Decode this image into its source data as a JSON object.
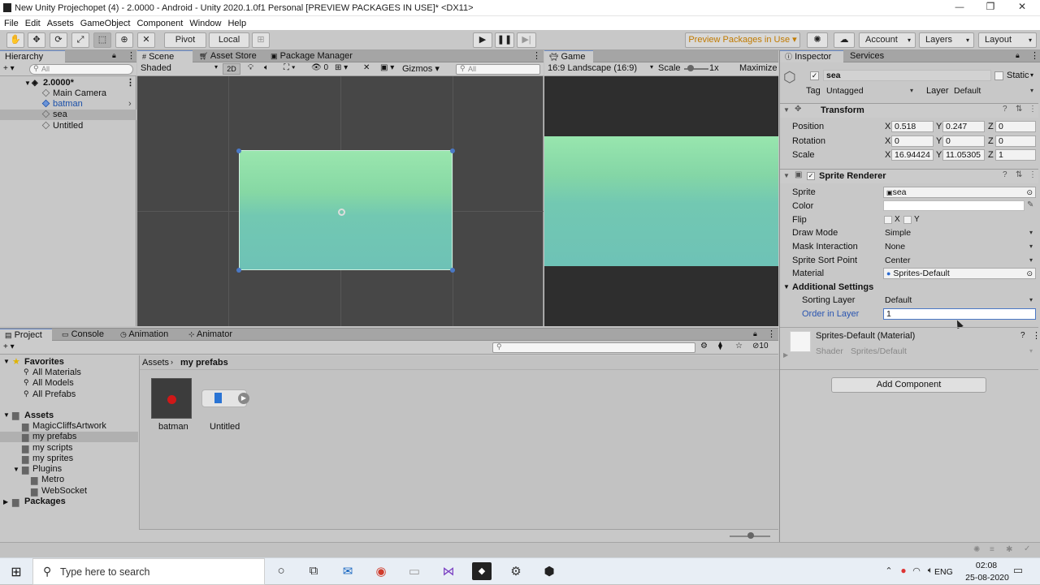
{
  "window": {
    "title": "New Unity Projechopet (4) - 2.0000 - Android - Unity 2020.1.0f1 Personal [PREVIEW PACKAGES IN USE]* <DX11>",
    "minimize": "—",
    "maximize": "❐",
    "close": "✕"
  },
  "menu": [
    "File",
    "Edit",
    "Assets",
    "GameObject",
    "Component",
    "Window",
    "Help"
  ],
  "toolbar": {
    "pivot": "Pivot",
    "local": "Local",
    "preview_packages": "Preview Packages in Use ▾",
    "account": "Account",
    "layers": "Layers",
    "layout": "Layout"
  },
  "hierarchy": {
    "tab": "Hierarchy",
    "search_placeholder": "All",
    "add": "+ ▾",
    "scene": "2.0000*",
    "items": [
      "Main Camera",
      "batman",
      "sea",
      "Untitled"
    ]
  },
  "scene_view": {
    "tabs": [
      "Scene",
      "Asset Store",
      "Package Manager"
    ],
    "shading": "Shaded",
    "mode_2d": "2D",
    "fx_count": "0",
    "gizmos": "Gizmos",
    "search_placeholder": "All"
  },
  "game_view": {
    "tab": "Game",
    "aspect": "16:9 Landscape (16:9)",
    "scale_label": "Scale",
    "scale_value": "1x",
    "maximize": "Maximize"
  },
  "inspector": {
    "tabs": [
      "Inspector",
      "Services"
    ],
    "object_name": "sea",
    "static_label": "Static",
    "tag_label": "Tag",
    "tag_value": "Untagged",
    "layer_label": "Layer",
    "layer_value": "Default",
    "transform": {
      "title": "Transform",
      "position_label": "Position",
      "position": {
        "x": "0.518",
        "y": "0.247",
        "z": "0"
      },
      "rotation_label": "Rotation",
      "rotation": {
        "x": "0",
        "y": "0",
        "z": "0"
      },
      "scale_label": "Scale",
      "scale": {
        "x": "16.94424",
        "y": "11.05305",
        "z": "1"
      }
    },
    "sprite_renderer": {
      "title": "Sprite Renderer",
      "sprite_label": "Sprite",
      "sprite_value": "sea",
      "color_label": "Color",
      "flip_label": "Flip",
      "flip_x": "X",
      "flip_y": "Y",
      "draw_mode_label": "Draw Mode",
      "draw_mode_value": "Simple",
      "mask_label": "Mask Interaction",
      "mask_value": "None",
      "sort_point_label": "Sprite Sort Point",
      "sort_point_value": "Center",
      "material_label": "Material",
      "material_value": "Sprites-Default",
      "additional_settings": "Additional Settings",
      "sorting_layer_label": "Sorting Layer",
      "sorting_layer_value": "Default",
      "order_label": "Order in Layer",
      "order_value": "1"
    },
    "material_block": {
      "title": "Sprites-Default (Material)",
      "shader_label": "Shader",
      "shader_value": "Sprites/Default"
    },
    "add_component": "Add Component"
  },
  "project": {
    "tabs": [
      "Project",
      "Console",
      "Animation",
      "Animator"
    ],
    "add": "+ ▾",
    "hidden_count": "10",
    "breadcrumb": [
      "Assets",
      "my prefabs"
    ],
    "favorites_label": "Favorites",
    "favorites": [
      "All Materials",
      "All Models",
      "All Prefabs"
    ],
    "assets_label": "Assets",
    "folders": [
      "MagicCliffsArtwork",
      "my prefabs",
      "my scripts",
      "my sprites"
    ],
    "plugins_label": "Plugins",
    "plugin_folders": [
      "Metro",
      "WebSocket"
    ],
    "packages_label": "Packages",
    "grid_items": [
      "batman",
      "Untitled"
    ]
  },
  "taskbar": {
    "search_placeholder": "Type here to search",
    "language": "ENG",
    "time": "02:08",
    "date": "25-08-2020"
  },
  "colors": {
    "accent": "#4a78c5",
    "sea_top": "#8fe0a8",
    "sea_bottom": "#6ec4b8",
    "editor_bg": "#c2c2c2"
  }
}
